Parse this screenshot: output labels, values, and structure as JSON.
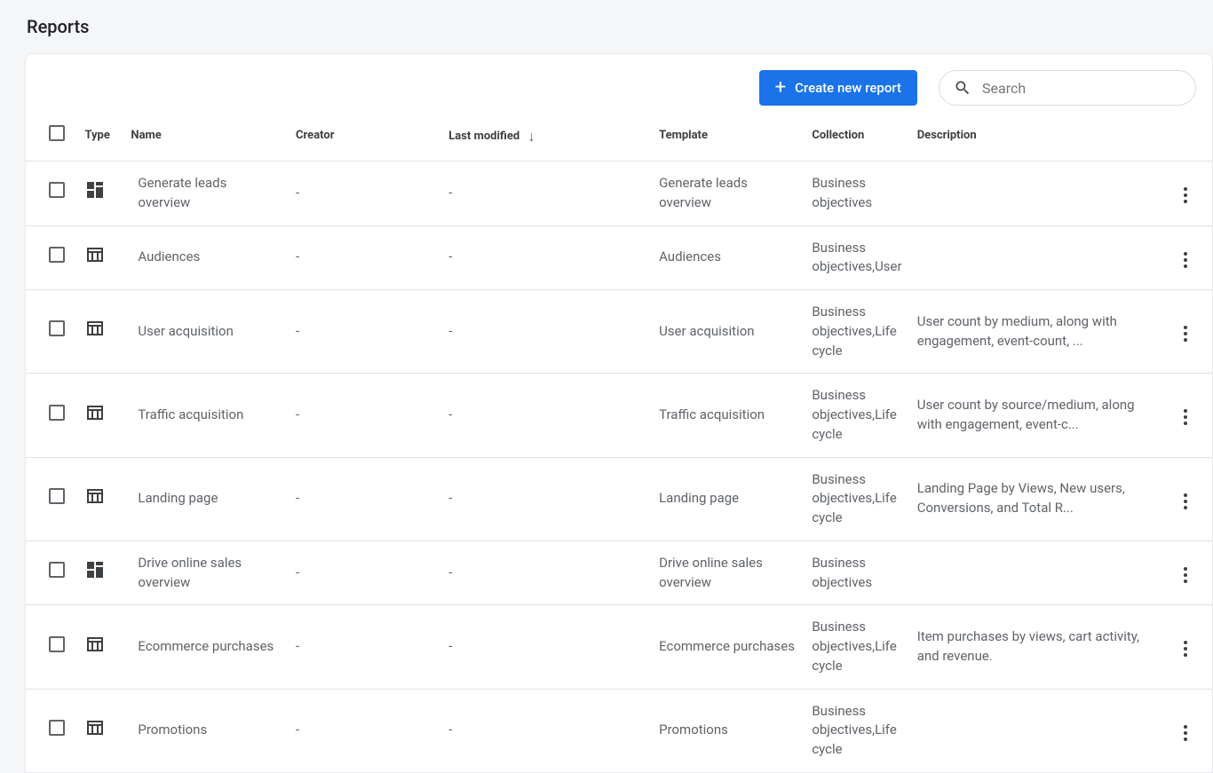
{
  "page": {
    "title": "Reports"
  },
  "toolbar": {
    "create_label": "Create new report",
    "search_placeholder": "Search"
  },
  "table": {
    "headers": {
      "type": "Type",
      "name": "Name",
      "creator": "Creator",
      "last_modified": "Last modified",
      "template": "Template",
      "collection": "Collection",
      "description": "Description"
    },
    "sort_column": "last_modified",
    "sort_dir": "desc",
    "rows": [
      {
        "icon": "dashboard",
        "name": "Generate leads overview",
        "creator": "-",
        "last_modified": "-",
        "template": "Generate leads overview",
        "collection": "Business objectives",
        "description": ""
      },
      {
        "icon": "table",
        "name": "Audiences",
        "creator": "-",
        "last_modified": "-",
        "template": "Audiences",
        "collection": "Business objectives,User",
        "description": ""
      },
      {
        "icon": "table",
        "name": "User acquisition",
        "creator": "-",
        "last_modified": "-",
        "template": "User acquisition",
        "collection": "Business objectives,Life cycle",
        "description": "User count by medium, along with engagement, event-count, ..."
      },
      {
        "icon": "table",
        "name": "Traffic acquisition",
        "creator": "-",
        "last_modified": "-",
        "template": "Traffic acquisition",
        "collection": "Business objectives,Life cycle",
        "description": "User count by source/medium, along with engagement, event-c..."
      },
      {
        "icon": "table",
        "name": "Landing page",
        "creator": "-",
        "last_modified": "-",
        "template": "Landing page",
        "collection": "Business objectives,Life cycle",
        "description": "Landing Page by Views, New users, Conversions, and Total R..."
      },
      {
        "icon": "dashboard",
        "name": "Drive online sales overview",
        "creator": "-",
        "last_modified": "-",
        "template": "Drive online sales overview",
        "collection": "Business objectives",
        "description": ""
      },
      {
        "icon": "table",
        "name": "Ecommerce purchases",
        "creator": "-",
        "last_modified": "-",
        "template": "Ecommerce purchases",
        "collection": "Business objectives,Life cycle",
        "description": "Item purchases by views, cart activity, and revenue."
      },
      {
        "icon": "table",
        "name": "Promotions",
        "creator": "-",
        "last_modified": "-",
        "template": "Promotions",
        "collection": "Business objectives,Life cycle",
        "description": ""
      }
    ]
  }
}
